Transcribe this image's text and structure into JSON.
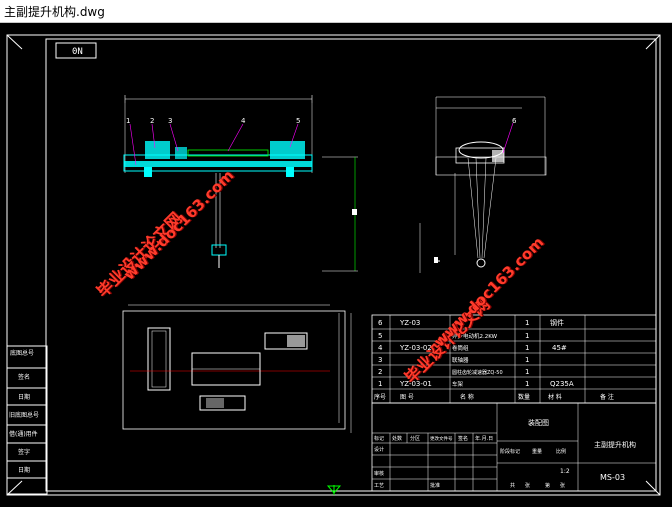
{
  "window": {
    "title": "主副提升机构.dwg"
  },
  "drawing": {
    "stamp": "0N",
    "parts_table": {
      "rows": [
        {
          "no": "6",
          "code": "YZ-03",
          "name": "",
          "qty": "1",
          "material": "钢件"
        },
        {
          "no": "5",
          "code": "",
          "name": "异步电动机2.2KW",
          "qty": "1",
          "material": ""
        },
        {
          "no": "4",
          "code": "YZ-03-02",
          "name": "卷筒组",
          "qty": "1",
          "material": "45#"
        },
        {
          "no": "3",
          "code": "",
          "name": "联轴器",
          "qty": "1",
          "material": ""
        },
        {
          "no": "2",
          "code": "",
          "name": "圆柱齿轮减速器ZQ-50",
          "qty": "1",
          "material": ""
        },
        {
          "no": "1",
          "code": "YZ-03-01",
          "name": "车架",
          "qty": "1",
          "material": "Q235A"
        }
      ],
      "header": {
        "no": "序号",
        "code": "图  号",
        "name": "名  称",
        "qty": "数量",
        "material": "材  料",
        "remark": "备  注"
      }
    },
    "title_block": {
      "drawing_title": "主副提升机构",
      "drawing_no": "MS-03",
      "assembly": "装配图",
      "scale": "1:2",
      "labels": [
        "标记",
        "处数",
        "分区",
        "更改文件号",
        "签名",
        "年.月.日"
      ],
      "labels2": [
        "设计",
        "审核",
        "工艺",
        "批准"
      ],
      "stage_labels": [
        "阶段标记",
        "重量",
        "比例"
      ],
      "sheet_labels": [
        "共",
        "张",
        "第",
        "张"
      ]
    },
    "side_labels": [
      "底图总号",
      "签名",
      "日期",
      "旧底图总号",
      "借(通)用件",
      "签字",
      "日期"
    ],
    "balloons": [
      "1",
      "2",
      "3",
      "4",
      "5",
      "6"
    ]
  },
  "watermarks": [
    {
      "text": "毕业设计论文网"
    },
    {
      "text": "www.doc163.com"
    },
    {
      "text": "毕业设计论文网"
    },
    {
      "text": "www.doc163.com"
    }
  ],
  "colors": {
    "background": "#000000",
    "border": "#ffffff",
    "green": "#00ff00",
    "cyan": "#00ffff",
    "watermark": "#ff3b2b"
  }
}
